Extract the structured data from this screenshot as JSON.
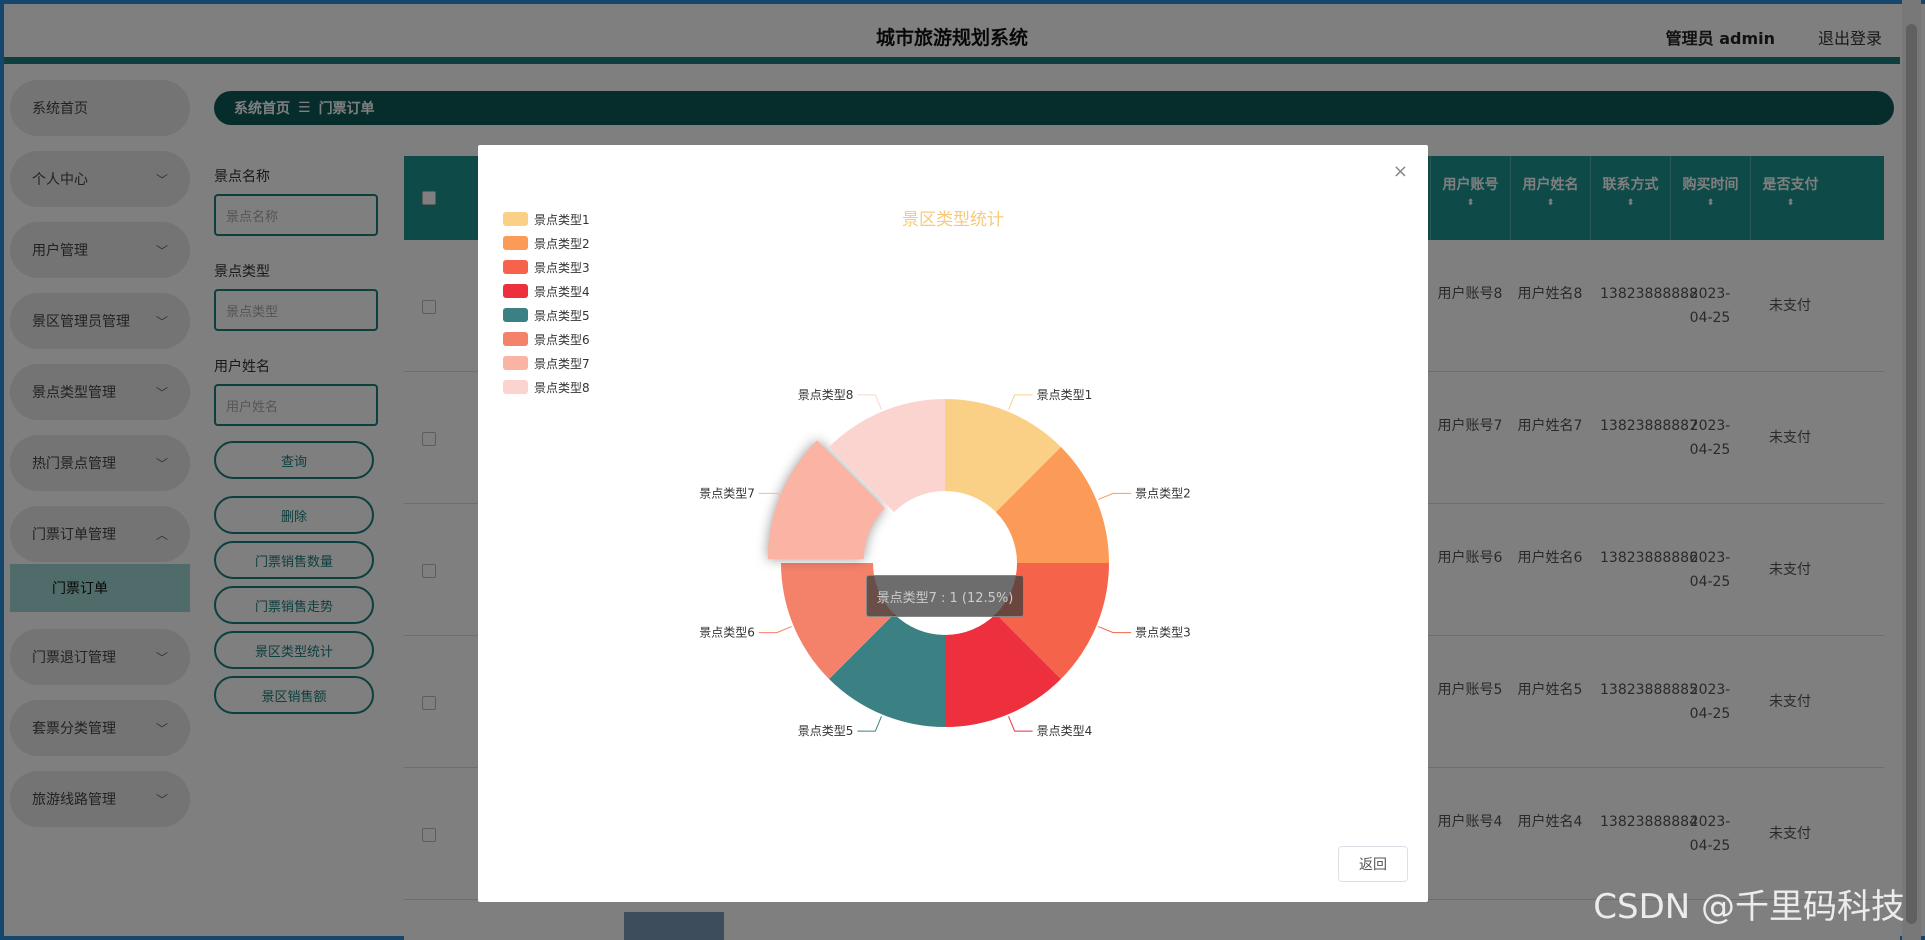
{
  "header": {
    "title": "城市旅游规划系统",
    "user": "管理员 admin",
    "logout": "退出登录"
  },
  "sidebar": {
    "items": [
      {
        "label": "系统首页",
        "chev": ""
      },
      {
        "label": "个人中心",
        "chev": "﹀"
      },
      {
        "label": "用户管理",
        "chev": "﹀"
      },
      {
        "label": "景区管理员管理",
        "chev": "﹀"
      },
      {
        "label": "景点类型管理",
        "chev": "﹀"
      },
      {
        "label": "热门景点管理",
        "chev": "﹀"
      },
      {
        "label": "门票订单管理",
        "chev": "︿"
      },
      {
        "label": "门票退订管理",
        "chev": "﹀"
      },
      {
        "label": "套票分类管理",
        "chev": "﹀"
      },
      {
        "label": "旅游线路管理",
        "chev": "﹀"
      }
    ],
    "sub_active": "门票订单"
  },
  "breadcrumb": {
    "home": "系统首页",
    "sep": "☰",
    "current": "门票订单"
  },
  "search": {
    "name_label": "景点名称",
    "name_placeholder": "景点名称",
    "type_label": "景点类型",
    "type_placeholder": "景点类型",
    "user_label": "用户姓名",
    "user_placeholder": "用户姓名"
  },
  "buttons": {
    "query": "查询",
    "delete": "删除",
    "sales_count": "门票销售数量",
    "sales_trend": "门票销售走势",
    "type_stats": "景区类型统计",
    "sales_amount": "景区销售额"
  },
  "table": {
    "headers": [
      "用户账号",
      "用户姓名",
      "联系方式",
      "购买时间",
      "是否支付"
    ],
    "sort": "⬍",
    "rows": [
      {
        "account": "用户账号8",
        "name": "用户姓名8",
        "phone": "13823888888",
        "time": "2023-04-25",
        "paid": "未支付"
      },
      {
        "account": "用户账号7",
        "name": "用户姓名7",
        "phone": "13823888887",
        "time": "2023-04-25",
        "paid": "未支付"
      },
      {
        "account": "用户账号6",
        "name": "用户姓名6",
        "phone": "13823888886",
        "time": "2023-04-25",
        "paid": "未支付"
      },
      {
        "account": "用户账号5",
        "name": "用户姓名5",
        "phone": "13823888885",
        "time": "2023-04-25",
        "paid": "未支付"
      },
      {
        "account": "用户账号4",
        "name": "用户姓名4",
        "phone": "13823888884",
        "time": "2023-04-25",
        "paid": "未支付"
      }
    ]
  },
  "modal": {
    "close": "×",
    "back": "返回",
    "tooltip": "景点类型7 : 1 (12.5%)"
  },
  "chart_data": {
    "type": "pie",
    "title": "景区类型统计",
    "categories": [
      "景点类型1",
      "景点类型2",
      "景点类型3",
      "景点类型4",
      "景点类型5",
      "景点类型6",
      "景点类型7",
      "景点类型8"
    ],
    "values": [
      1,
      1,
      1,
      1,
      1,
      1,
      1,
      1
    ],
    "colors": [
      "#f9d086",
      "#fb9b57",
      "#f5644a",
      "#ee2f3d",
      "#3b8183",
      "#f4826b",
      "#fbb4a3",
      "#fcd4cf"
    ],
    "legend": "top-left",
    "highlighted": "景点类型7"
  },
  "watermark": "CSDN @千里码科技"
}
